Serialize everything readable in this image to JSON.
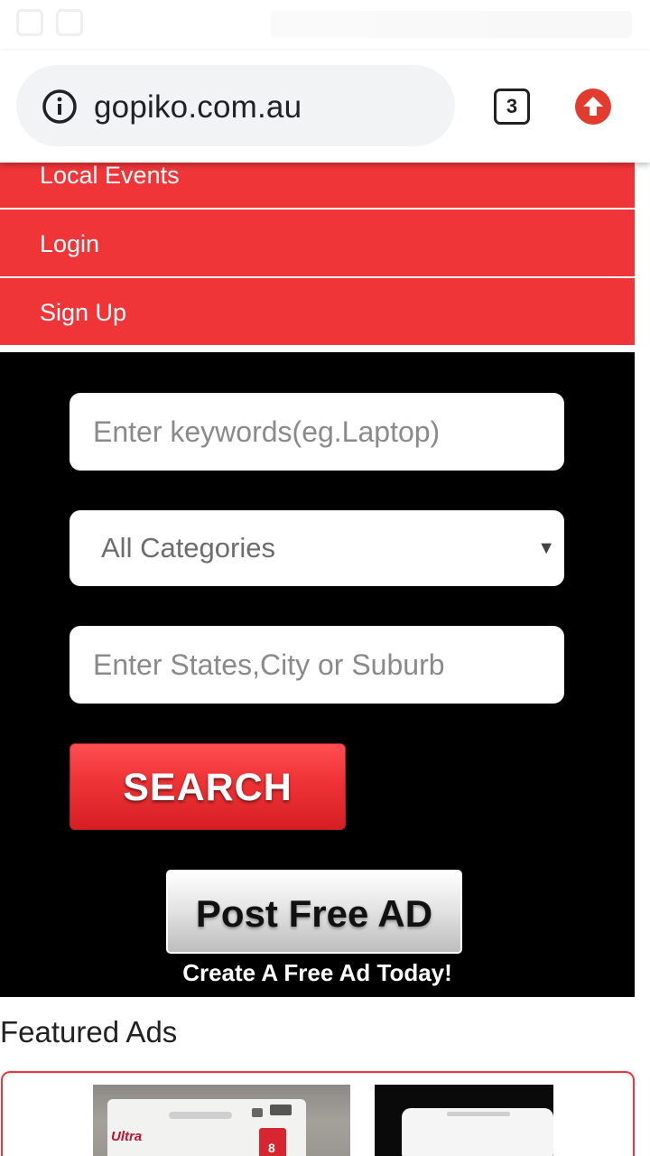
{
  "browser": {
    "url": "gopiko.com.au",
    "tab_count": "3"
  },
  "menu": {
    "items": [
      {
        "label": "Local Events"
      },
      {
        "label": "Login"
      },
      {
        "label": "Sign Up"
      }
    ]
  },
  "search": {
    "keyword_placeholder": "Enter keywords(eg.Laptop)",
    "category_selected": "All Categories",
    "location_placeholder": "Enter States,City or Suburb",
    "search_label": "SEARCH"
  },
  "post_ad": {
    "button_label": "Post Free AD",
    "subtitle": "Create A Free Ad Today!"
  },
  "featured": {
    "title": "Featured Ads"
  },
  "colors": {
    "brand_red": "#f03538",
    "panel_bg": "#000000",
    "upload_red": "#e23c2f"
  },
  "icons": {
    "info": "info-icon",
    "tabs": "tab-switcher-icon",
    "upload": "upload-arrow-icon",
    "dropdown": "chevron-down-icon"
  }
}
